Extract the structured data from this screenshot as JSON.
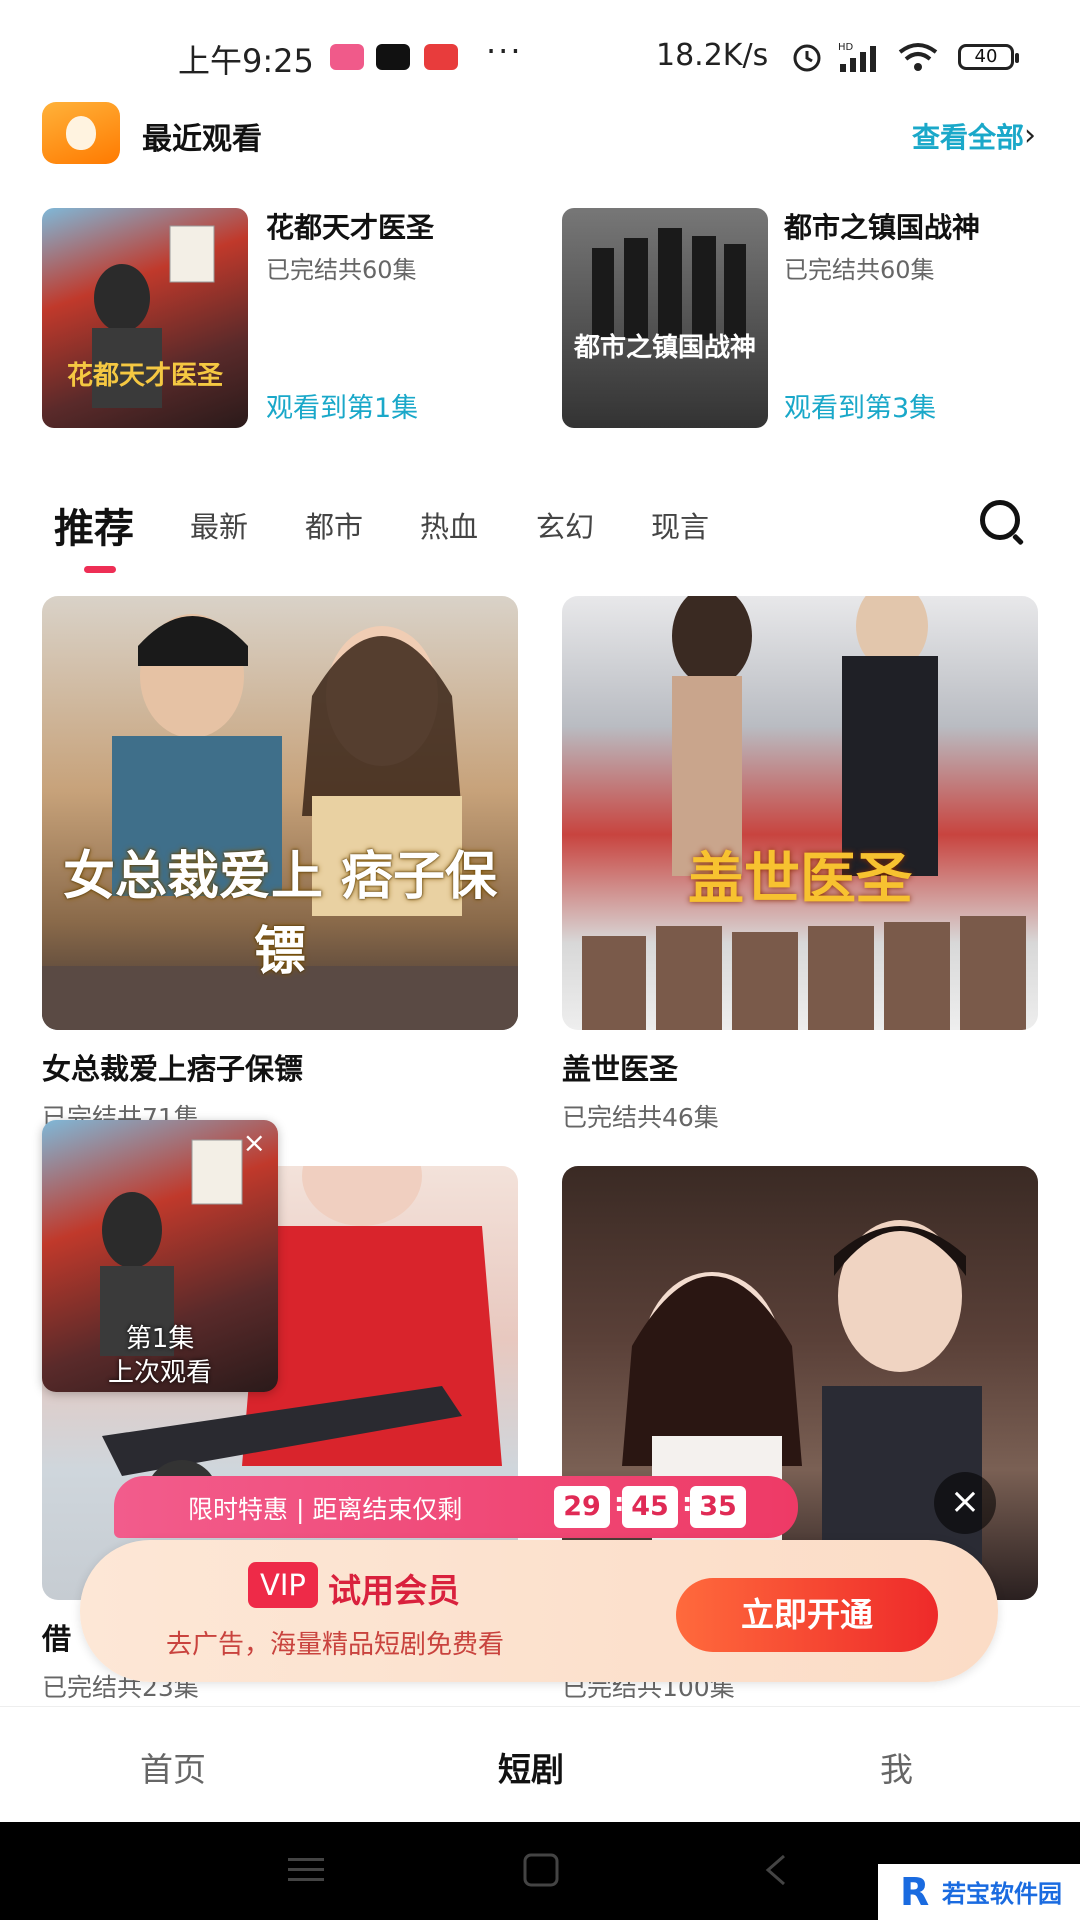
{
  "status_bar": {
    "time": "上午9:25",
    "dots": "···",
    "network_speed": "18.2K/s",
    "hd": "HD",
    "battery": "40"
  },
  "recent": {
    "title": "最近观看",
    "view_all": "查看全部",
    "items": [
      {
        "title": "花都天才医圣",
        "status": "已完结共60集",
        "progress": "观看到第1集"
      },
      {
        "title": "都市之镇国战神",
        "status": "已完结共60集",
        "progress": "观看到第3集"
      }
    ]
  },
  "tabs": [
    "推荐",
    "最新",
    "都市",
    "热血",
    "玄幻",
    "现言"
  ],
  "cards": [
    {
      "title": "女总裁爱上痞子保镖",
      "status": "已完结共71集",
      "poster_text": "女总裁爱上 痞子保镖"
    },
    {
      "title": "盖世医圣",
      "status": "已完结共46集",
      "poster_text": "盖世医圣"
    },
    {
      "title": "借",
      "status": "已完结共23集",
      "poster_text": ""
    },
    {
      "title": "",
      "status": "已完结共100集",
      "poster_text": ""
    }
  ],
  "mini_player": {
    "episode": "第1集",
    "label": "上次观看",
    "close": "×"
  },
  "promo": {
    "strip_text": "限时特惠 | 距离结束仅剩",
    "countdown": [
      "29",
      "45",
      "35"
    ],
    "vip_badge": "VIP",
    "vip_title": "试用会员",
    "vip_sub": "去广告，海量精品短剧免费看",
    "button": "立即开通",
    "close": "×"
  },
  "bottom_nav": [
    "首页",
    "短剧",
    "我"
  ],
  "watermark": {
    "logo": "R",
    "text": "若宝软件园"
  },
  "colors": {
    "accent_blue": "#1aa8c9",
    "accent_red": "#ee2e55",
    "vip_red": "#ee2a48"
  }
}
